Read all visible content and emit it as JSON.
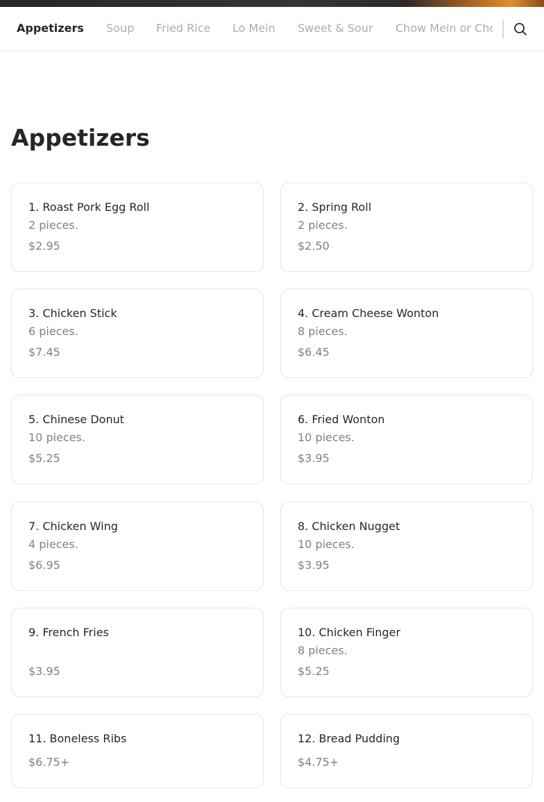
{
  "nav": {
    "tabs": [
      {
        "label": "Appetizers",
        "active": true
      },
      {
        "label": "Soup",
        "active": false
      },
      {
        "label": "Fried Rice",
        "active": false
      },
      {
        "label": "Lo Mein",
        "active": false
      },
      {
        "label": "Sweet & Sour",
        "active": false
      },
      {
        "label": "Chow Mein or Chop Suey",
        "active": false
      }
    ],
    "search_icon": "search-icon"
  },
  "section": {
    "title": "Appetizers",
    "items": [
      {
        "name": "1. Roast Pork Egg Roll",
        "description": "2 pieces.",
        "price": "$2.95"
      },
      {
        "name": "2. Spring Roll",
        "description": "2 pieces.",
        "price": "$2.50"
      },
      {
        "name": "3. Chicken Stick",
        "description": "6 pieces.",
        "price": "$7.45"
      },
      {
        "name": "4. Cream Cheese Wonton",
        "description": "8 pieces.",
        "price": "$6.45"
      },
      {
        "name": "5. Chinese Donut",
        "description": "10 pieces.",
        "price": "$5.25"
      },
      {
        "name": "6. Fried Wonton",
        "description": "10 pieces.",
        "price": "$3.95"
      },
      {
        "name": "7. Chicken Wing",
        "description": "4 pieces.",
        "price": "$6.95"
      },
      {
        "name": "8. Chicken Nugget",
        "description": "10 pieces.",
        "price": "$3.95"
      },
      {
        "name": "9. French Fries",
        "description": "",
        "price": "$3.95"
      },
      {
        "name": "10. Chicken Finger",
        "description": "8 pieces.",
        "price": "$5.25"
      },
      {
        "name": "11. Boneless Ribs",
        "description": "",
        "price": "$6.75+"
      },
      {
        "name": "12. Bread Pudding",
        "description": "",
        "price": "$4.75+"
      }
    ]
  },
  "colors": {
    "text_primary": "#23272b",
    "text_muted": "#7c8288",
    "tab_inactive": "#a8adb2",
    "card_border": "#e3e5e7"
  }
}
